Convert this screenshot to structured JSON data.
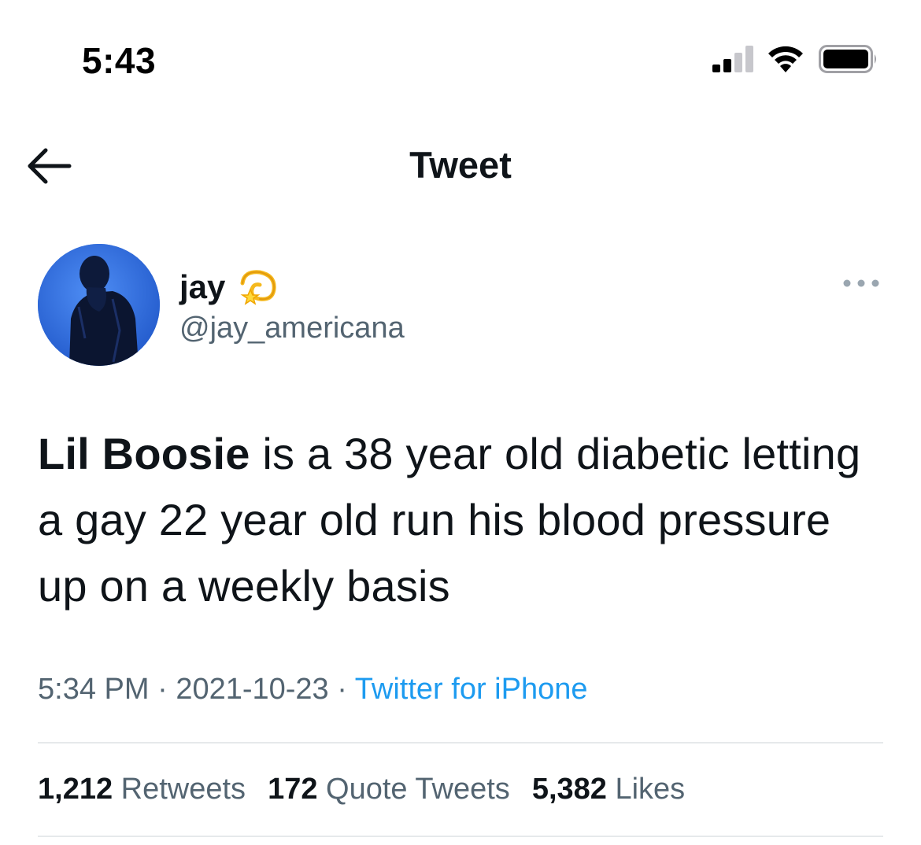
{
  "status_bar": {
    "time": "5:43"
  },
  "nav": {
    "title": "Tweet"
  },
  "author": {
    "display_name": "jay",
    "handle": "@jay_americana",
    "badge_icon": "dizzy-emoji"
  },
  "tweet": {
    "text_bold": "Lil Boosie",
    "text_rest": " is a 38 year old diabetic letting a gay 22 year old run his blood pressure up on a weekly basis"
  },
  "meta": {
    "time": "5:34 PM",
    "separator": "·",
    "date": "2021-10-23",
    "source": "Twitter for iPhone"
  },
  "stats": {
    "retweets_count": "1,212",
    "retweets_label": "Retweets",
    "quotes_count": "172",
    "quotes_label": "Quote Tweets",
    "likes_count": "5,382",
    "likes_label": "Likes"
  },
  "colors": {
    "link": "#1d9bf0",
    "secondary_text": "#536471",
    "primary_text": "#0f1419",
    "divider": "#e6e9eb"
  }
}
